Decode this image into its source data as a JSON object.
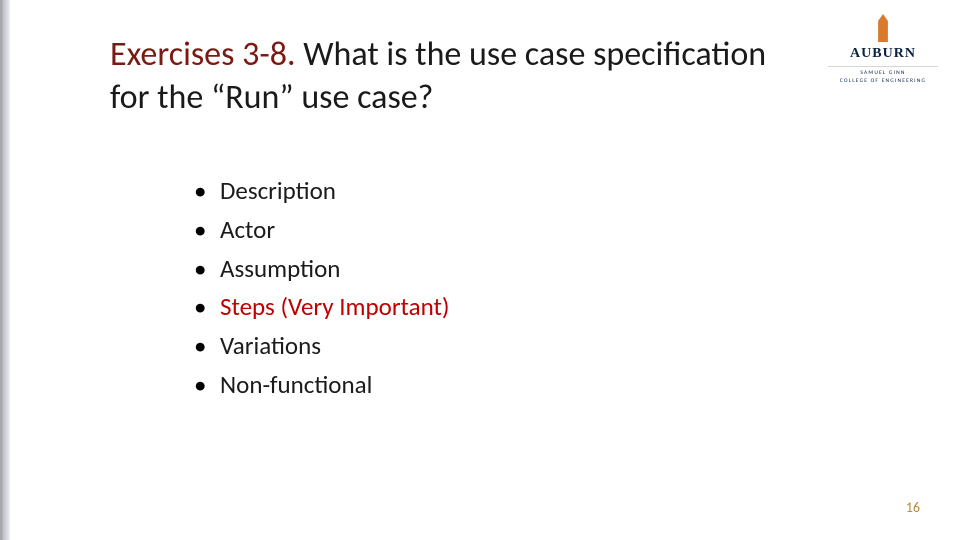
{
  "title": {
    "prefix": "Exercises 3-8.",
    "rest": " What is the use case specification for the “Run” use case?"
  },
  "bullets": [
    {
      "text": "Description",
      "important": false
    },
    {
      "text": "Actor",
      "important": false
    },
    {
      "text": "Assumption",
      "important": false
    },
    {
      "text": "Steps (Very Important)",
      "important": true
    },
    {
      "text": "Variations",
      "important": false
    },
    {
      "text": "Non-functional",
      "important": false
    }
  ],
  "logo": {
    "name": "AUBURN",
    "subline1": "SAMUEL GINN",
    "subline2": "COLLEGE OF ENGINEERING"
  },
  "page_number": "16"
}
